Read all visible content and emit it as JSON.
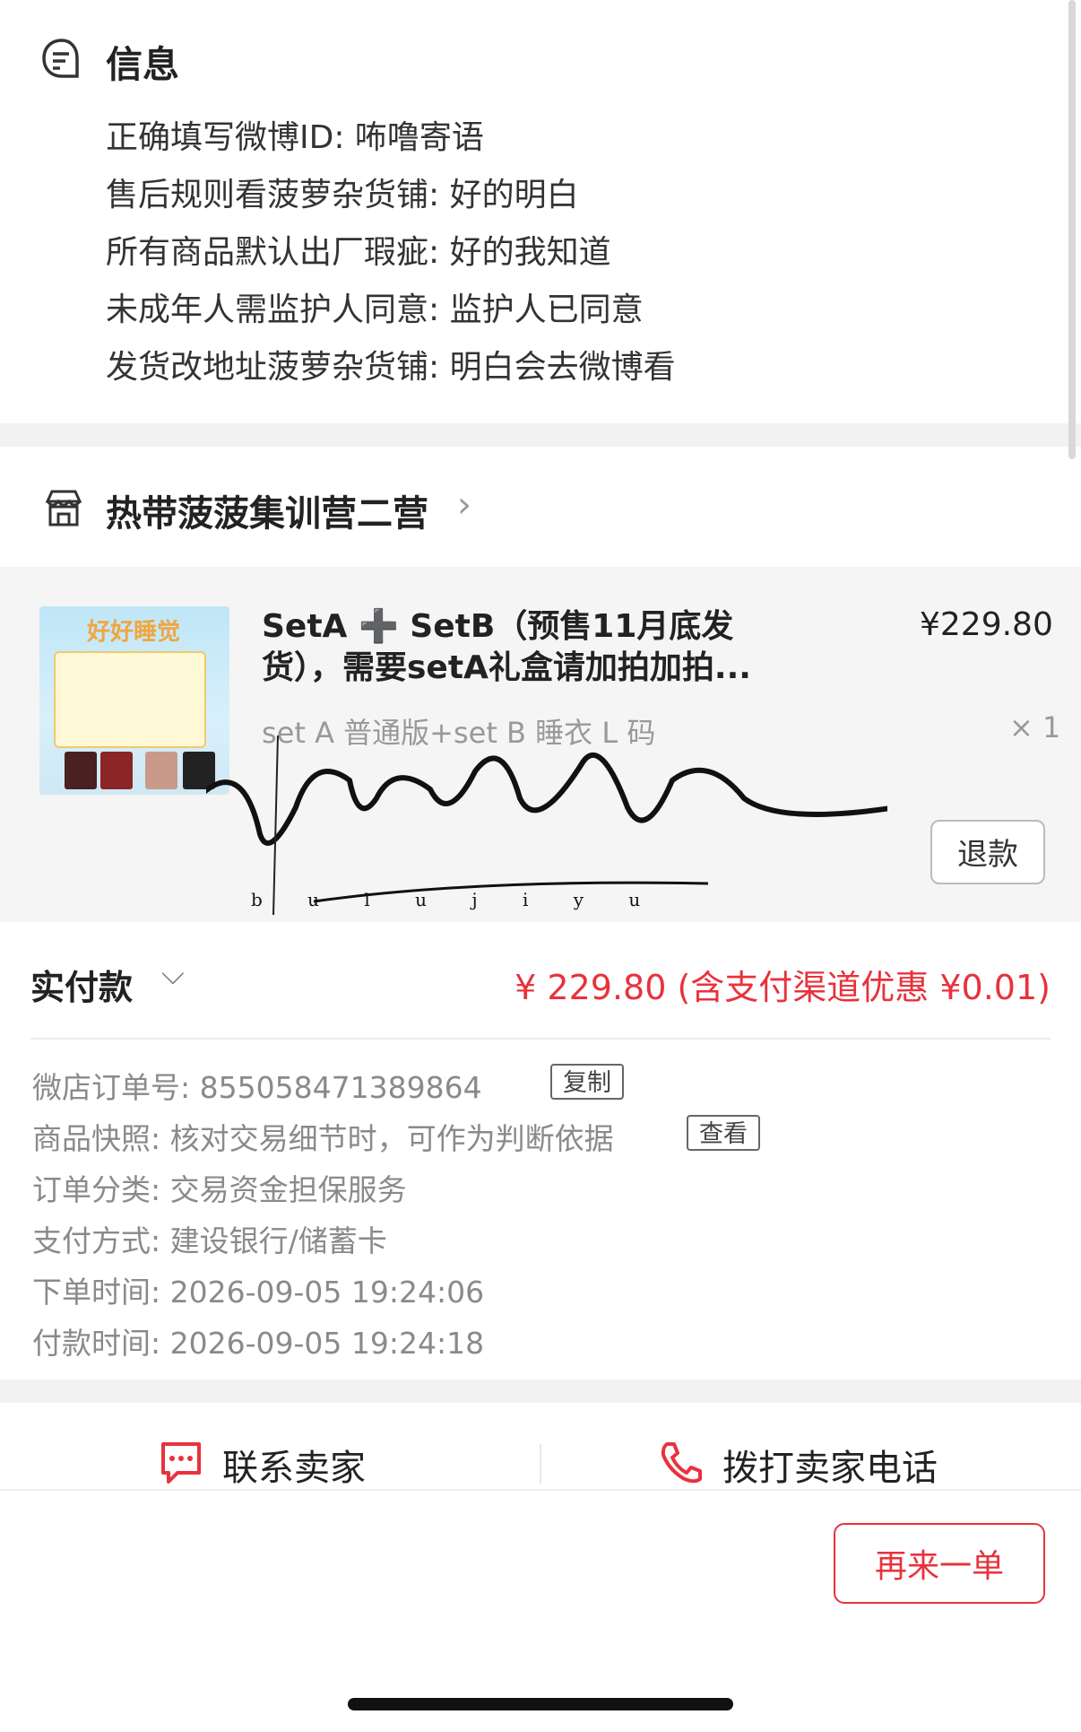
{
  "info": {
    "title": "信息",
    "lines": [
      "正确填写微博ID: 咘噜寄语",
      "售后规则看菠萝杂货铺: 好的明白",
      "所有商品默认出厂瑕疵: 好的我知道",
      "未成年人需监护人同意: 监护人已同意",
      "发货改地址菠萝杂货铺: 明白会去微博看"
    ]
  },
  "store": {
    "name": "热带菠菠集训营二营"
  },
  "product": {
    "title": "SetA ➕ SetB（预售11月底发货），需要setA礼盒请加拍加拍...",
    "variant": "set A 普通版+set B 睡衣 L 码",
    "price": "¥229.80",
    "qty": "× 1",
    "refund_label": "退款",
    "thumb_title": "好好睡觉"
  },
  "watermark": {
    "text": "咘噜寄语",
    "sub": "b u l u j i y u"
  },
  "payment": {
    "label": "实付款",
    "amount": "¥ 229.80 (含支付渠道优惠 ¥0.01)"
  },
  "details": {
    "order_no": {
      "label": "微店订单号:",
      "value": "855058471389864",
      "btn": "复制"
    },
    "snapshot": {
      "label": "商品快照:",
      "value": "核对交易细节时，可作为判断依据",
      "btn": "查看"
    },
    "category": {
      "label": "订单分类:",
      "value": "交易资金担保服务"
    },
    "pay_method": {
      "label": "支付方式:",
      "value": "建设银行/储蓄卡"
    },
    "order_time": {
      "label": "下单时间:",
      "value": "2026-09-05 19:24:06"
    },
    "pay_time": {
      "label": "付款时间:",
      "value": "2026-09-05 19:24:18"
    }
  },
  "actions": {
    "contact_seller": "联系卖家",
    "call_seller": "拨打卖家电话",
    "reorder": "再来一单"
  },
  "colors": {
    "accent": "#e8323c",
    "muted": "#8a8a8a",
    "card_bg": "#f5f5f5"
  }
}
